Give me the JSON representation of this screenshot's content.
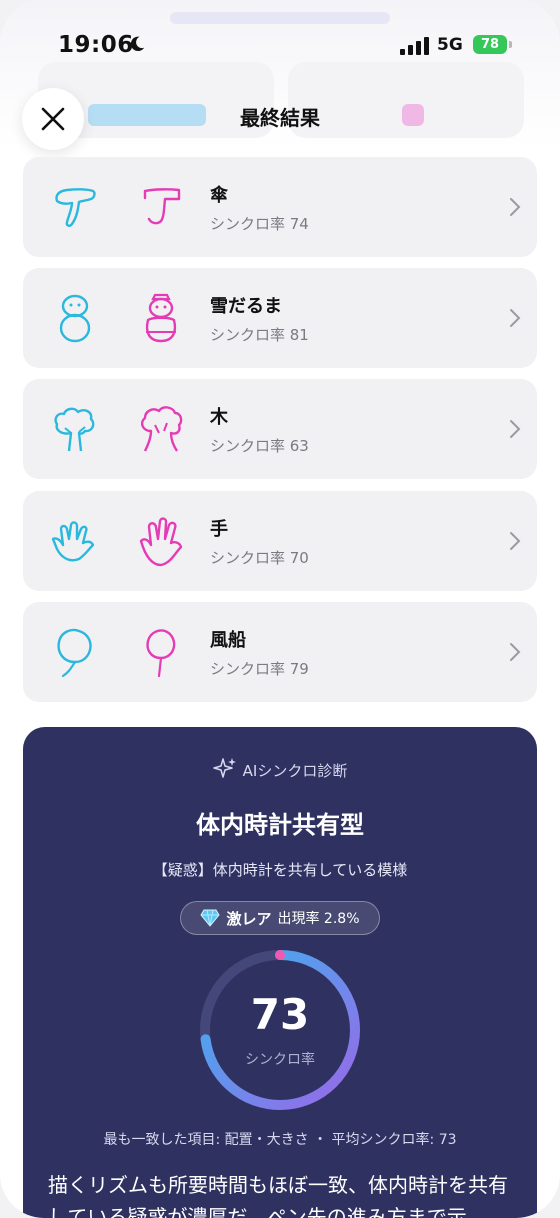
{
  "status_bar": {
    "time": "19:06",
    "network": "5G",
    "battery": "78"
  },
  "header": {
    "title": "最終結果",
    "close_icon": "close-icon"
  },
  "results": [
    {
      "name": "傘",
      "score_text": "シンクロ率 74",
      "drawing": "umbrella"
    },
    {
      "name": "雪だるま",
      "score_text": "シンクロ率 81",
      "drawing": "snowman"
    },
    {
      "name": "木",
      "score_text": "シンクロ率 63",
      "drawing": "tree"
    },
    {
      "name": "手",
      "score_text": "シンクロ率 70",
      "drawing": "hand"
    },
    {
      "name": "風船",
      "score_text": "シンクロ率 79",
      "drawing": "balloon"
    }
  ],
  "colors": {
    "player_a": "#2ab8dc",
    "player_b": "#e43cb4",
    "panel": "#2f3260",
    "gauge_start": "#38b6ef",
    "gauge_end": "#9a67e8"
  },
  "ai_diagnosis": {
    "heading": "AIシンクロ診断",
    "type_name": "体内時計共有型",
    "subtitle": "【疑惑】体内時計を共有している模様",
    "rarity_label": "激レア",
    "rarity_rate": "出現率 2.8%",
    "score": "73",
    "score_fraction": 0.73,
    "score_label": "シンクロ率",
    "meta": "最も一致した項目: 配置・大きさ ・ 平均シンクロ率: 73",
    "description": "描くリズムも所要時間もほぼ一致、体内時計を共有している疑惑が濃厚だ。ペン先の進み方まで示"
  }
}
